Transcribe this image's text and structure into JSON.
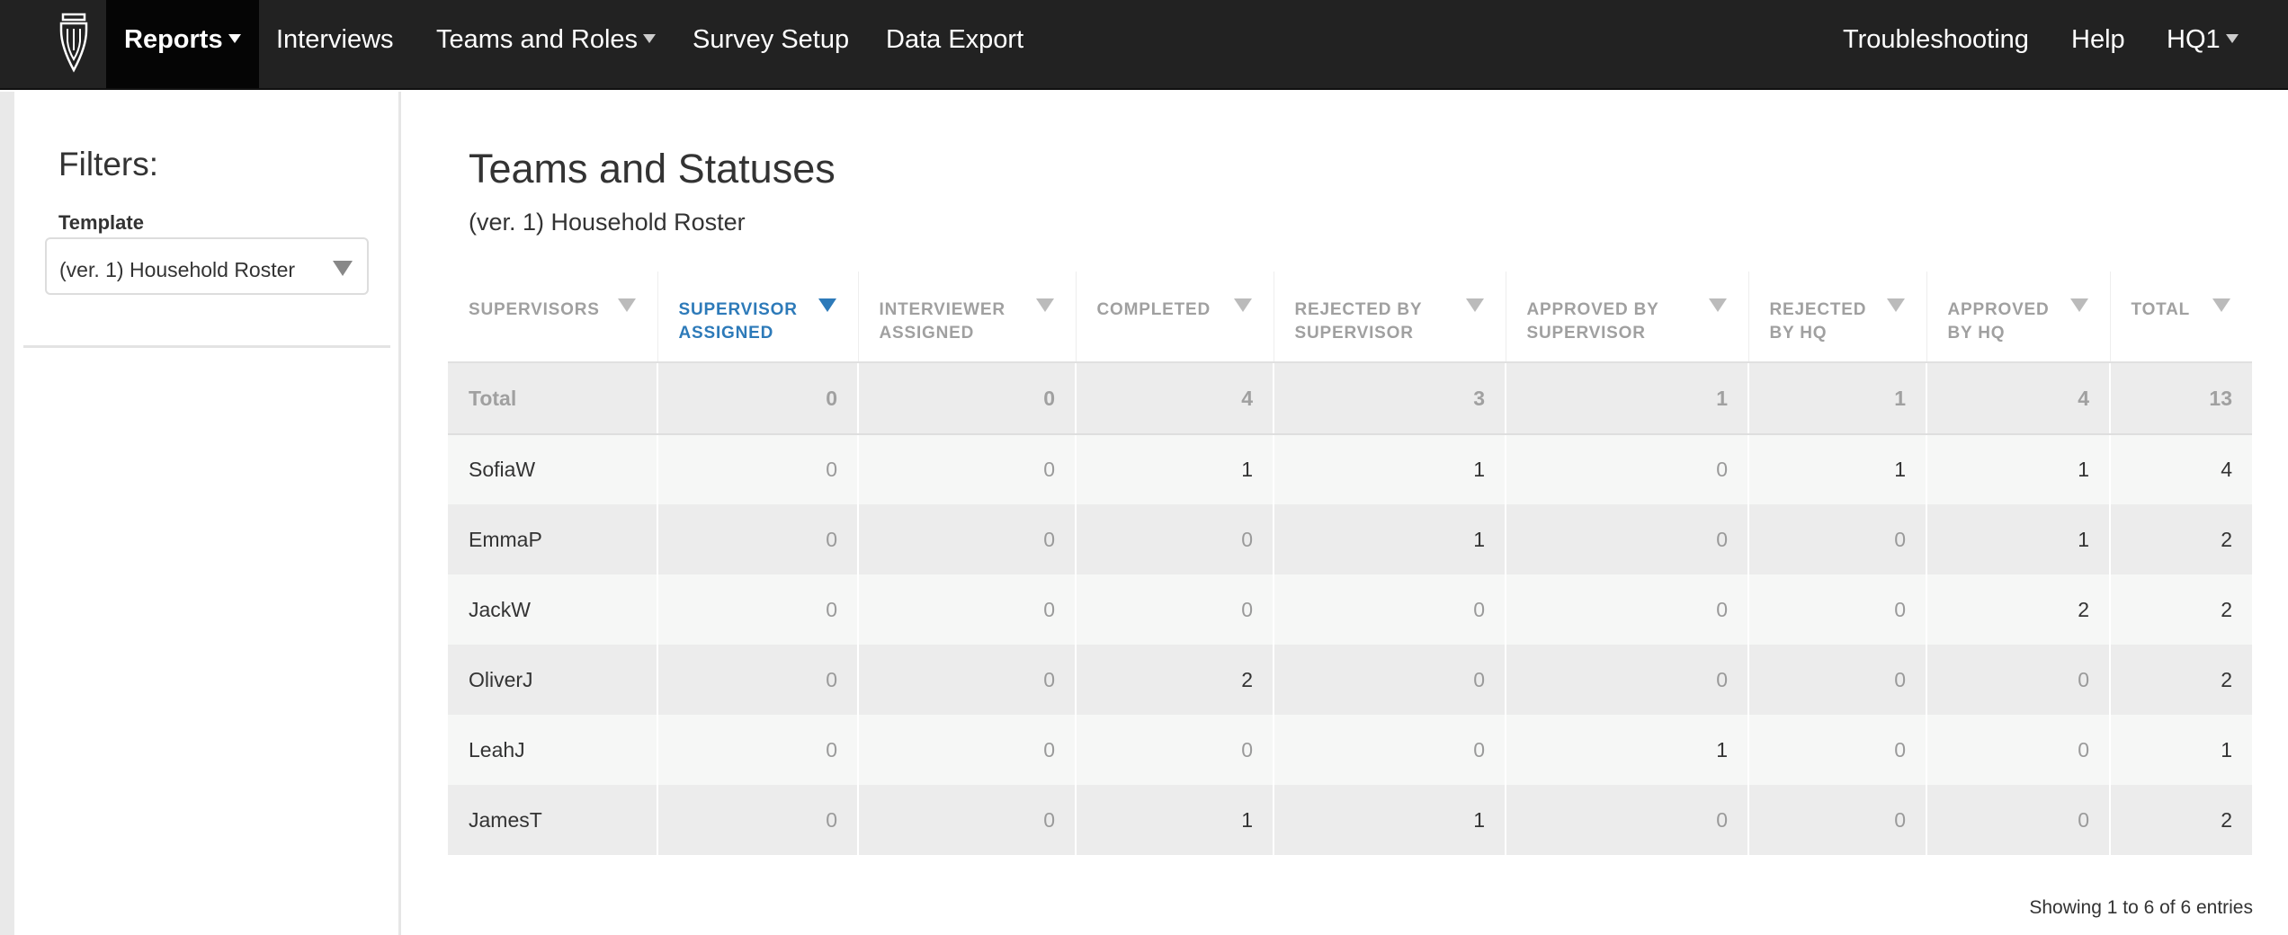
{
  "nav": {
    "items": [
      {
        "label": "Reports",
        "dropdown": true,
        "active": true
      },
      {
        "label": "Interviews",
        "dropdown": false
      },
      {
        "label": "Teams and Roles",
        "dropdown": true
      },
      {
        "label": "Survey Setup",
        "dropdown": false
      },
      {
        "label": "Data Export",
        "dropdown": false
      }
    ],
    "right_items": [
      {
        "label": "Troubleshooting",
        "dropdown": false
      },
      {
        "label": "Help",
        "dropdown": false
      },
      {
        "label": "HQ1",
        "dropdown": true
      }
    ]
  },
  "sidebar": {
    "title": "Filters:",
    "template_label": "Template",
    "template_value": "(ver. 1) Household Roster"
  },
  "main": {
    "title": "Teams and Statuses",
    "subtitle": "(ver. 1) Household Roster"
  },
  "table": {
    "columns": [
      {
        "label": "SUPERVISORS",
        "sorted": false
      },
      {
        "label": "SUPERVISOR ASSIGNED",
        "sorted": true
      },
      {
        "label": "INTERVIEWER ASSIGNED",
        "sorted": false
      },
      {
        "label": "COMPLETED",
        "sorted": false
      },
      {
        "label": "REJECTED BY SUPERVISOR",
        "sorted": false
      },
      {
        "label": "APPROVED BY SUPERVISOR",
        "sorted": false
      },
      {
        "label": "REJECTED BY HQ",
        "sorted": false
      },
      {
        "label": "APPROVED BY HQ",
        "sorted": false
      },
      {
        "label": "TOTAL",
        "sorted": false
      }
    ],
    "total_row": [
      "Total",
      "0",
      "0",
      "4",
      "3",
      "1",
      "1",
      "4",
      "13"
    ],
    "rows": [
      [
        "SofiaW",
        "0",
        "0",
        "1",
        "1",
        "0",
        "1",
        "1",
        "4"
      ],
      [
        "EmmaP",
        "0",
        "0",
        "0",
        "1",
        "0",
        "0",
        "1",
        "2"
      ],
      [
        "JackW",
        "0",
        "0",
        "0",
        "0",
        "0",
        "0",
        "2",
        "2"
      ],
      [
        "OliverJ",
        "0",
        "0",
        "2",
        "0",
        "0",
        "0",
        "0",
        "2"
      ],
      [
        "LeahJ",
        "0",
        "0",
        "0",
        "0",
        "1",
        "0",
        "0",
        "1"
      ],
      [
        "JamesT",
        "0",
        "0",
        "1",
        "1",
        "0",
        "0",
        "0",
        "2"
      ]
    ]
  },
  "footer": {
    "entries_info": "Showing 1 to 6 of 6 entries"
  },
  "colors": {
    "navbar": "#222222",
    "active_nav": "#050505",
    "sorted_header": "#2d7ab9",
    "muted_text": "#9a9a9a"
  }
}
